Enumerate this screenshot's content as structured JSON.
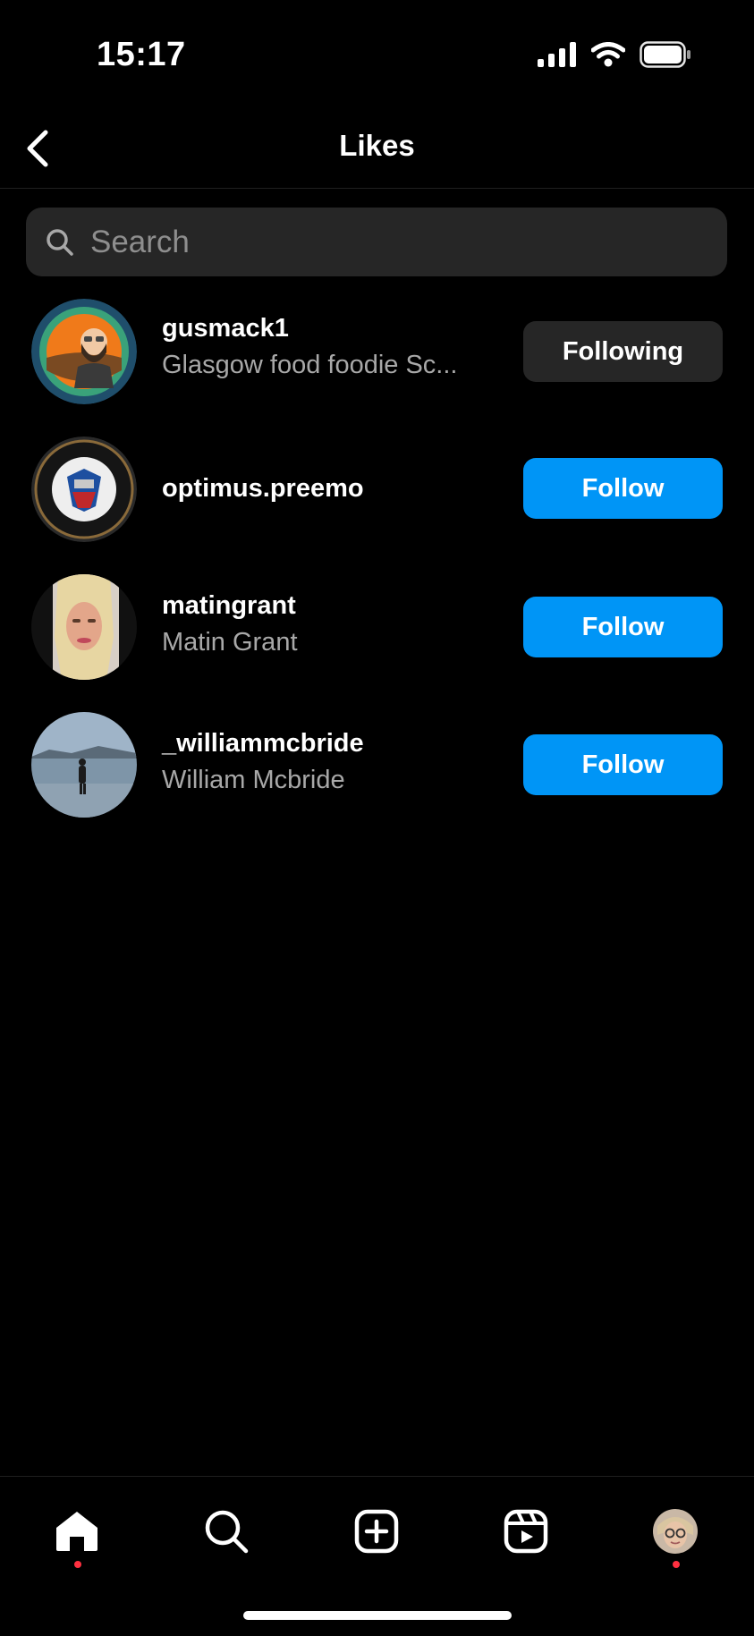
{
  "status": {
    "time": "15:17"
  },
  "header": {
    "title": "Likes"
  },
  "search": {
    "placeholder": "Search"
  },
  "users": [
    {
      "username": "gusmack1",
      "full_name": "Glasgow food foodie Sc...",
      "button": "Following"
    },
    {
      "username": "optimus.preemo",
      "full_name": "",
      "button": "Follow"
    },
    {
      "username": "matingrant",
      "full_name": "Matin Grant",
      "button": "Follow"
    },
    {
      "username": "_williammcbride",
      "full_name": "William Mcbride",
      "button": "Follow"
    }
  ],
  "tabs": [
    "home-icon",
    "search-icon",
    "create-icon",
    "reels-icon",
    "profile-avatar"
  ],
  "colors": {
    "accent": "#0095f6",
    "surface": "#262626",
    "notification": "#ff3040"
  }
}
